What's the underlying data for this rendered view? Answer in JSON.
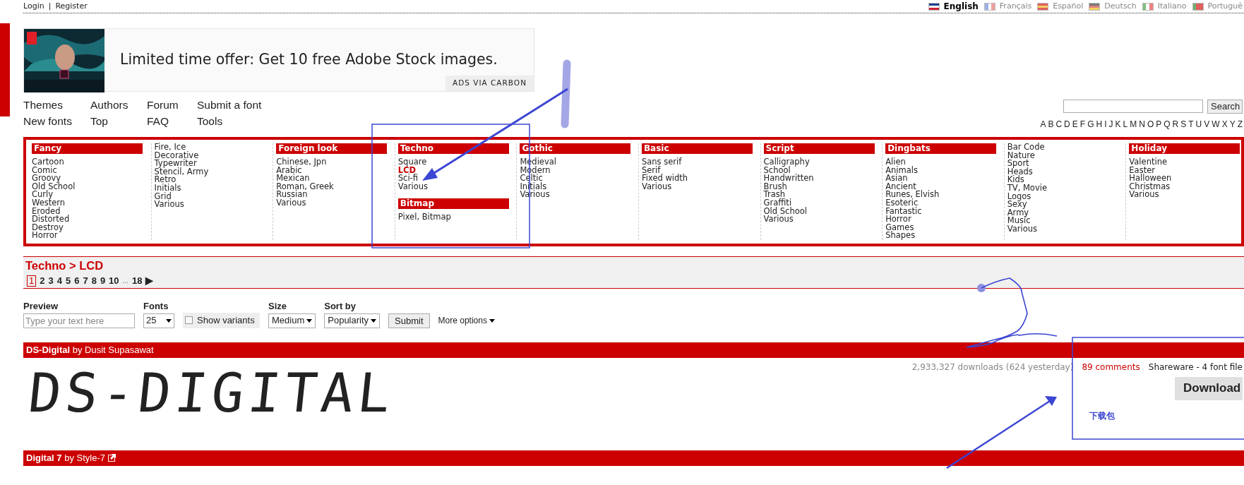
{
  "account_links": [
    {
      "label": "Login"
    },
    {
      "label": "Register"
    }
  ],
  "account_separator": "|",
  "languages": [
    {
      "label": "English",
      "kind": "uk",
      "selected": true
    },
    {
      "label": "Français",
      "kind": "fr",
      "selected": false
    },
    {
      "label": "Español",
      "kind": "es",
      "selected": false
    },
    {
      "label": "Deutsch",
      "kind": "de",
      "selected": false
    },
    {
      "label": "Italiano",
      "kind": "it",
      "selected": false
    },
    {
      "label": "Portuguê",
      "kind": "pt",
      "selected": false
    }
  ],
  "ad": {
    "headline": "Limited time offer: Get 10 free Adobe Stock images.",
    "badge": "ADS VIA CARBON"
  },
  "nav": [
    [
      "Themes",
      "New fonts"
    ],
    [
      "Authors",
      "Top"
    ],
    [
      "Forum",
      "FAQ"
    ],
    [
      "Submit a font",
      "Tools"
    ]
  ],
  "search": {
    "button": "Search"
  },
  "alphabet": [
    "A",
    "B",
    "C",
    "D",
    "E",
    "F",
    "G",
    "H",
    "I",
    "J",
    "K",
    "L",
    "M",
    "N",
    "O",
    "P",
    "Q",
    "R",
    "S",
    "T",
    "U",
    "V",
    "W",
    "X",
    "Y",
    "Z"
  ],
  "categories": [
    {
      "sections": [
        {
          "title": "Fancy",
          "items": [
            {
              "label": "Cartoon",
              "selected": false
            },
            {
              "label": "Comic",
              "selected": false
            },
            {
              "label": "Groovy",
              "selected": false
            },
            {
              "label": "Old School",
              "selected": false
            },
            {
              "label": "Curly",
              "selected": false
            },
            {
              "label": "Western",
              "selected": false
            },
            {
              "label": "Eroded",
              "selected": false
            },
            {
              "label": "Distorted",
              "selected": false
            },
            {
              "label": "Destroy",
              "selected": false
            },
            {
              "label": "Horror",
              "selected": false
            }
          ]
        }
      ]
    },
    {
      "sections": [
        {
          "items": [
            {
              "label": "Fire, Ice",
              "selected": false
            },
            {
              "label": "Decorative",
              "selected": false
            },
            {
              "label": "Typewriter",
              "selected": false
            },
            {
              "label": "Stencil, Army",
              "selected": false
            },
            {
              "label": "Retro",
              "selected": false
            },
            {
              "label": "Initials",
              "selected": false
            },
            {
              "label": "Grid",
              "selected": false
            },
            {
              "label": "Various",
              "selected": false
            }
          ]
        }
      ]
    },
    {
      "sections": [
        {
          "title": "Foreign look",
          "items": [
            {
              "label": "Chinese, Jpn",
              "selected": false
            },
            {
              "label": "Arabic",
              "selected": false
            },
            {
              "label": "Mexican",
              "selected": false
            },
            {
              "label": "Roman, Greek",
              "selected": false
            },
            {
              "label": "Russian",
              "selected": false
            },
            {
              "label": "Various",
              "selected": false
            }
          ]
        }
      ]
    },
    {
      "sections": [
        {
          "title": "Techno",
          "items": [
            {
              "label": "Square",
              "selected": false
            },
            {
              "label": "LCD",
              "selected": true
            },
            {
              "label": "Sci-fi",
              "selected": false
            },
            {
              "label": "Various",
              "selected": false
            }
          ]
        },
        {
          "title": "Bitmap",
          "items": [
            {
              "label": "Pixel, Bitmap",
              "selected": false
            }
          ]
        }
      ]
    },
    {
      "sections": [
        {
          "title": "Gothic",
          "items": [
            {
              "label": "Medieval",
              "selected": false
            },
            {
              "label": "Modern",
              "selected": false
            },
            {
              "label": "Celtic",
              "selected": false
            },
            {
              "label": "Initials",
              "selected": false
            },
            {
              "label": "Various",
              "selected": false
            }
          ]
        }
      ]
    },
    {
      "sections": [
        {
          "title": "Basic",
          "items": [
            {
              "label": "Sans serif",
              "selected": false
            },
            {
              "label": "Serif",
              "selected": false
            },
            {
              "label": "Fixed width",
              "selected": false
            },
            {
              "label": "Various",
              "selected": false
            }
          ]
        }
      ]
    },
    {
      "sections": [
        {
          "title": "Script",
          "items": [
            {
              "label": "Calligraphy",
              "selected": false
            },
            {
              "label": "School",
              "selected": false
            },
            {
              "label": "Handwritten",
              "selected": false
            },
            {
              "label": "Brush",
              "selected": false
            },
            {
              "label": "Trash",
              "selected": false
            },
            {
              "label": "Graffiti",
              "selected": false
            },
            {
              "label": "Old School",
              "selected": false
            },
            {
              "label": "Various",
              "selected": false
            }
          ]
        }
      ]
    },
    {
      "sections": [
        {
          "title": "Dingbats",
          "items": [
            {
              "label": "Alien",
              "selected": false
            },
            {
              "label": "Animals",
              "selected": false
            },
            {
              "label": "Asian",
              "selected": false
            },
            {
              "label": "Ancient",
              "selected": false
            },
            {
              "label": "Runes, Elvish",
              "selected": false
            },
            {
              "label": "Esoteric",
              "selected": false
            },
            {
              "label": "Fantastic",
              "selected": false
            },
            {
              "label": "Horror",
              "selected": false
            },
            {
              "label": "Games",
              "selected": false
            },
            {
              "label": "Shapes",
              "selected": false
            }
          ]
        }
      ]
    },
    {
      "sections": [
        {
          "items": [
            {
              "label": "Bar Code",
              "selected": false
            },
            {
              "label": "Nature",
              "selected": false
            },
            {
              "label": "Sport",
              "selected": false
            },
            {
              "label": "Heads",
              "selected": false
            },
            {
              "label": "Kids",
              "selected": false
            },
            {
              "label": "TV, Movie",
              "selected": false
            },
            {
              "label": "Logos",
              "selected": false
            },
            {
              "label": "Sexy",
              "selected": false
            },
            {
              "label": "Army",
              "selected": false
            },
            {
              "label": "Music",
              "selected": false
            },
            {
              "label": "Various",
              "selected": false
            }
          ]
        }
      ]
    },
    {
      "sections": [
        {
          "title": "Holiday",
          "items": [
            {
              "label": "Valentine",
              "selected": false
            },
            {
              "label": "Easter",
              "selected": false
            },
            {
              "label": "Halloween",
              "selected": false
            },
            {
              "label": "Christmas",
              "selected": false
            },
            {
              "label": "Various",
              "selected": false
            }
          ]
        }
      ]
    }
  ],
  "breadcrumb": "Techno > LCD",
  "pages": [
    {
      "label": "1",
      "selected": true
    },
    {
      "label": "2",
      "selected": false
    },
    {
      "label": "3",
      "selected": false
    },
    {
      "label": "4",
      "selected": false
    },
    {
      "label": "5",
      "selected": false
    },
    {
      "label": "6",
      "selected": false
    },
    {
      "label": "7",
      "selected": false
    },
    {
      "label": "8",
      "selected": false
    },
    {
      "label": "9",
      "selected": false
    },
    {
      "label": "10",
      "selected": false
    },
    {
      "label": "...",
      "kind": "gap"
    },
    {
      "label": "18",
      "selected": false
    },
    {
      "label": "▶",
      "kind": "next"
    }
  ],
  "filters": {
    "preview": {
      "label": "Preview",
      "placeholder": "Type your text here"
    },
    "fonts": {
      "label": "Fonts",
      "value": "25"
    },
    "show_variants": {
      "label": "Show variants",
      "checked": false
    },
    "size": {
      "label": "Size",
      "value": "Medium"
    },
    "sort": {
      "label": "Sort by",
      "value": "Popularity"
    },
    "submit": "Submit",
    "more_options": "More options"
  },
  "fonts": [
    {
      "title": "**DS-Digital** by Dusit Supasawat",
      "external_link": false,
      "downloads": "2,933,327 downloads (624 yesterday)",
      "comments": "89 comments",
      "license": "Shareware - 4 font file",
      "download": "Download",
      "preview": "DS-DIGITAL"
    },
    {
      "title": "**Digital 7** by Style-7",
      "external_link": true
    }
  ],
  "annotation_note": "下载包"
}
